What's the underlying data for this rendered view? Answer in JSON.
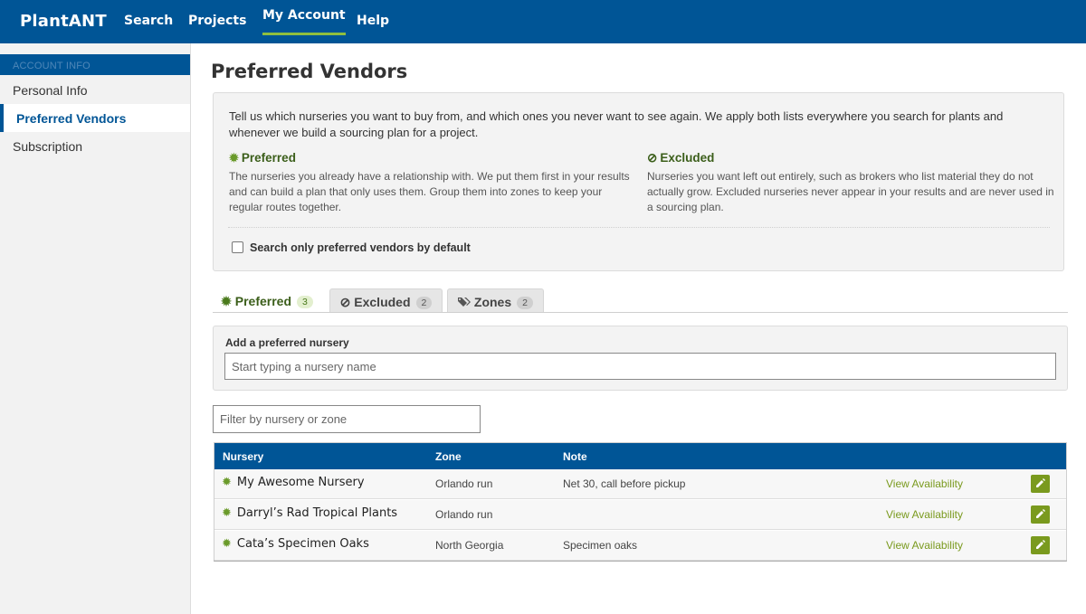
{
  "topnav": {
    "brand": "PlantANT",
    "items": [
      {
        "label": "Search"
      },
      {
        "label": "Projects"
      },
      {
        "label": "My Account"
      },
      {
        "label": "Help"
      }
    ]
  },
  "sidebar": {
    "section": "ACCOUNT INFO",
    "items": [
      {
        "label": "Personal Info"
      },
      {
        "label": "Preferred Vendors"
      },
      {
        "label": "Subscription"
      }
    ]
  },
  "page": {
    "title": "Preferred Vendors",
    "intro": "Tell us which nurseries you want to buy from, and which ones you never want to see again. We apply both lists everywhere you search for plants and whenever we build a sourcing plan for a project.",
    "preferred": {
      "icon": "gear-icon",
      "title": "Preferred",
      "text": "The nurseries you already have a relationship with. We put them first in your results and can build a plan that only uses them. Group them into zones to keep your regular routes together."
    },
    "excluded": {
      "icon": "ban-icon",
      "title": "Excluded",
      "text": "Nurseries you want left out entirely, such as brokers who list material they do not actually grow. Excluded nurseries never appear in your results and are never used in a sourcing plan."
    },
    "checkbox_label": "Search only preferred vendors by default",
    "checkbox_checked": false
  },
  "tabs": [
    {
      "label": "Preferred",
      "count": "3",
      "icon": "gear-icon"
    },
    {
      "label": "Excluded",
      "count": "2",
      "icon": "ban-icon"
    },
    {
      "label": "Zones",
      "count": "2",
      "icon": "tags-icon"
    }
  ],
  "add_nursery": {
    "label": "Add a preferred nursery",
    "placeholder": "Start typing a nursery name"
  },
  "filter": {
    "placeholder": "Filter by nursery or zone"
  },
  "table": {
    "headers": [
      "Nursery",
      "Zone",
      "Note"
    ],
    "action_label": "View Availability",
    "rows": [
      {
        "name": "My Awesome Nursery",
        "zone": "Orlando run",
        "note": "Net 30, call before pickup"
      },
      {
        "name": "Darryl’s Rad Tropical Plants",
        "zone": "Orlando run",
        "note": ""
      },
      {
        "name": "Cata’s Specimen Oaks",
        "zone": "North Georgia",
        "note": "Specimen oaks"
      }
    ]
  },
  "colors": {
    "primary": "#005596",
    "accent_green": "#7a9a1e",
    "nav_underline": "#8fbf3f"
  }
}
